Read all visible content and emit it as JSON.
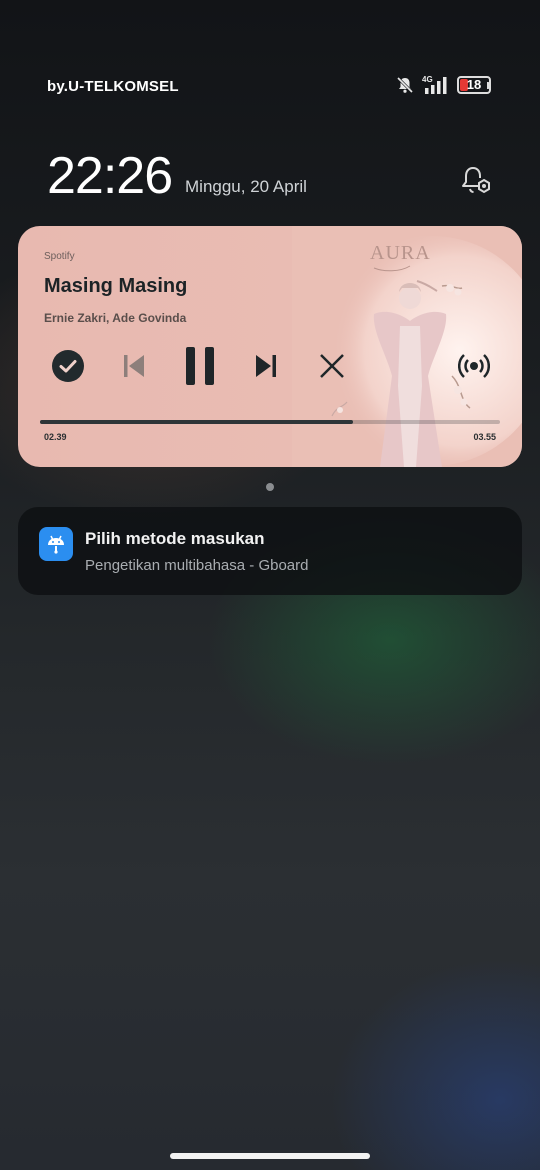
{
  "status_bar": {
    "carrier": "by.U-TELKOMSEL",
    "network_type": "4G",
    "battery_level": "18",
    "icons": [
      "mute-icon",
      "signal-icon",
      "battery-icon"
    ]
  },
  "lockscreen": {
    "time": "22:26",
    "date": "Minggu, 20 April"
  },
  "media": {
    "app": "Spotify",
    "title": "Masing Masing",
    "artist": "Ernie Zakri, Ade Govinda",
    "album_text": "AURA",
    "elapsed": "02.39",
    "total": "03.55",
    "progress": 0.68,
    "accent_color": "#e8b9b0",
    "controls": [
      "saved-check-icon",
      "previous-icon",
      "pause-icon",
      "next-icon",
      "close-icon",
      "broadcast-icon"
    ]
  },
  "notification": {
    "title": "Pilih metode masukan",
    "text": "Pengetikan multibahasa - Gboard",
    "icon": "android-icon",
    "icon_color": "#2b8ef0"
  }
}
